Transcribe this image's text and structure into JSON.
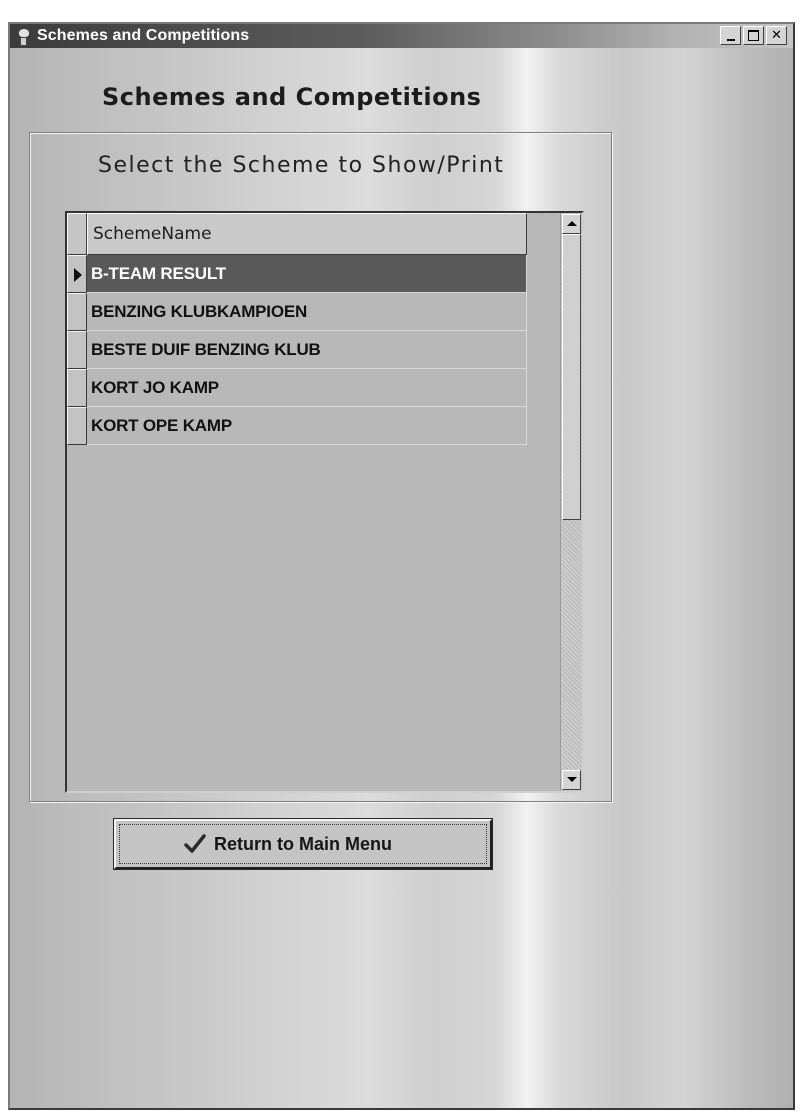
{
  "window": {
    "title": "Schemes and Competitions",
    "icon": "pigeon-app-icon",
    "controls": [
      "minimize",
      "maximize",
      "close"
    ]
  },
  "heading": "Schemes and Competitions",
  "prompt": "Select the Scheme to Show/Print",
  "grid": {
    "column_header": "SchemeName",
    "selected_index": 0,
    "rows": [
      "B-TEAM RESULT",
      "BENZING KLUBKAMPIOEN",
      "BESTE DUIF BENZING KLUB",
      "KORT JO KAMP",
      "KORT OPE KAMP"
    ]
  },
  "return_button": {
    "label": "Return to Main Menu",
    "icon": "checkmark-icon"
  },
  "colors": {
    "selected_row": "#595959",
    "titlebar_dark": "#3c3c3c"
  }
}
